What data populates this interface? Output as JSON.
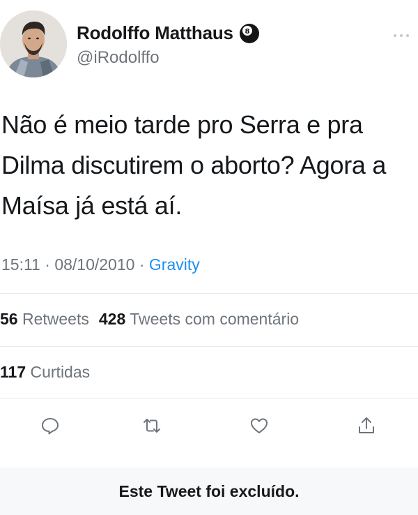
{
  "author": {
    "display_name": "Rodolffo Matthaus",
    "handle": "@iRodolffo",
    "badge_icon": "eight-ball-icon"
  },
  "tweet": {
    "text_lines": [
      "Não é meio tarde pro Serra e pra",
      "Dilma discutirem o aborto? Agora a",
      "Maísa já está aí."
    ]
  },
  "meta": {
    "time": "15:11",
    "separator": " · ",
    "date": "08/10/2010",
    "source": "Gravity"
  },
  "stats": {
    "retweets_count": "56",
    "retweets_label": "Retweets",
    "quotes_count": "428",
    "quotes_label": "Tweets com comentário",
    "likes_count": "117",
    "likes_label": "Curtidas"
  },
  "actions": [
    "reply-icon",
    "retweet-icon",
    "like-icon",
    "share-icon"
  ],
  "banner": {
    "deleted_text": "Este Tweet foi excluído."
  },
  "colors": {
    "link": "#1d8ef0",
    "muted": "#6d747b",
    "text": "#16181b"
  }
}
